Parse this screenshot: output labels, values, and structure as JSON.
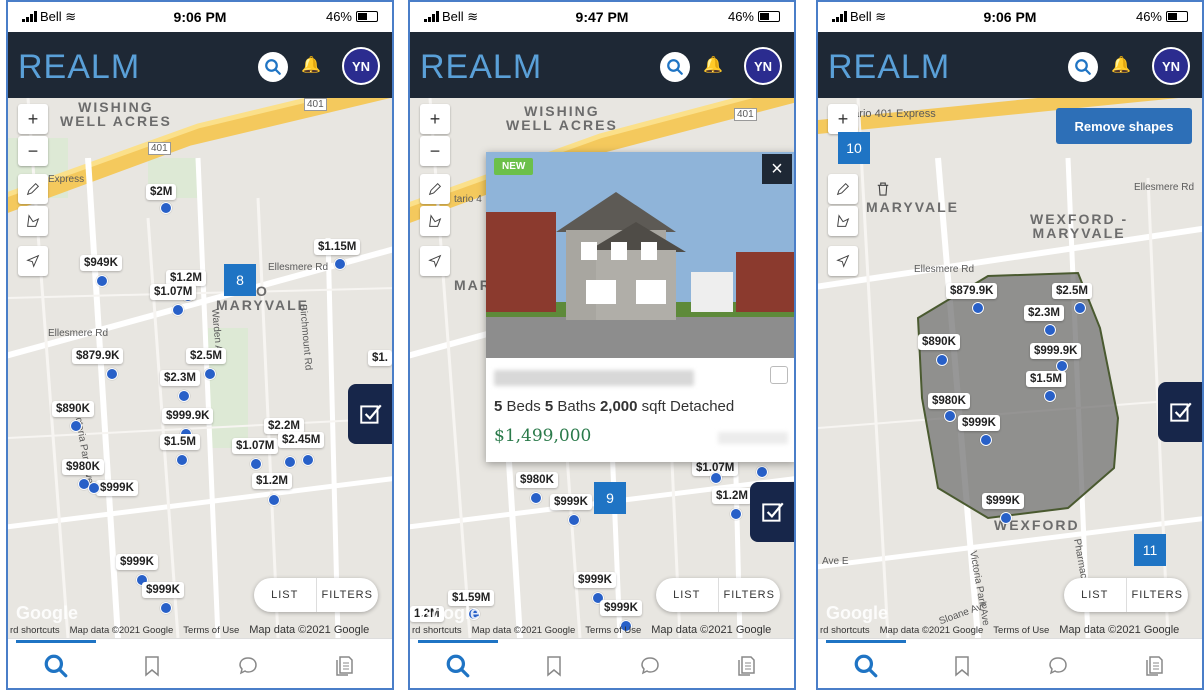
{
  "screens": [
    {
      "status": {
        "carrier": "Bell",
        "time": "9:06 PM",
        "battery": "46%"
      },
      "header": {
        "logo": "REALM",
        "avatar": "YN"
      },
      "map_labels": {
        "area1": "WISHING\nWELL ACRES",
        "area2": "O\nMARYVALE",
        "hwy": "401",
        "hwy2": "401",
        "express": "Express",
        "ellesmere": "Ellesmere Rd",
        "ellesmere2": "Ellesmere Rd",
        "birchmount": "Birchmount Rd",
        "victoria": "Victoria Park Ave",
        "warden": "Warden Ave"
      },
      "prices": [
        "$2M",
        "$1.15M",
        "$949K",
        "$1.2M",
        "$1.07M",
        "$879.9K",
        "$2.5M",
        "$2.3M",
        "$890K",
        "$999.9K",
        "$2.2M",
        "$1.5M",
        "$1.07M",
        "$2.45M",
        "$980K",
        "$1.2M",
        "$999K",
        "$999K",
        "$999K",
        "$1."
      ],
      "cluster": "8",
      "list_label": "LIST",
      "filters_label": "FILTERS",
      "footer": {
        "shortcuts": "rd shortcuts",
        "mapdata": "Map data ©2021 Google",
        "terms": "Terms of Use",
        "mapdata2": "Map data ©2021 Google"
      }
    },
    {
      "status": {
        "carrier": "Bell",
        "time": "9:47 PM",
        "battery": "46%"
      },
      "header": {
        "logo": "REALM",
        "avatar": "YN"
      },
      "map_labels": {
        "area1": "WISHING\nWELL ACRES",
        "area2": "MAR",
        "hwy": "401",
        "express": "tario 4"
      },
      "card": {
        "badge": "NEW",
        "beds": "5",
        "beds_label": "Beds",
        "baths": "5",
        "baths_label": "Baths",
        "sqft": "2,000",
        "sqft_label": "sqft",
        "type": "Detached",
        "price": "$1,499,000"
      },
      "prices": [
        "$980K",
        "$999K",
        "$1.07M",
        "$1.2M",
        "$999K",
        "$1.59M",
        "$999K",
        "1.2M"
      ],
      "cluster": "9",
      "list_label": "LIST",
      "filters_label": "FILTERS",
      "footer": {
        "shortcuts": "rd shortcuts",
        "mapdata": "Map data ©2021 Google",
        "terms": "Terms of Use",
        "mapdata2": "Map data ©2021 Google"
      }
    },
    {
      "status": {
        "carrier": "Bell",
        "time": "9:06 PM",
        "battery": "46%"
      },
      "header": {
        "logo": "REALM",
        "avatar": "YN"
      },
      "map_labels": {
        "area1": "MARYVALE",
        "area2": "WEXFORD -\nMARYVALE",
        "area3": "WEXFORD",
        "express": "ntario 401 Express",
        "ellesmere": "Ellesmere Rd",
        "ellesmere2": "Ellesmere Rd",
        "victoria": "Victoria Park Ave",
        "pharmacy": "Pharmacy Ave",
        "sloane": "Sloane Ave",
        "avee": "Ave E"
      },
      "remove_shapes": "Remove shapes",
      "prices": [
        "$879.9K",
        "$2.5M",
        "$2.3M",
        "$890K",
        "$999.9K",
        "$1.5M",
        "$980K",
        "$999K",
        "$999K"
      ],
      "cluster_a": "10",
      "cluster_b": "11",
      "list_label": "LIST",
      "filters_label": "FILTERS",
      "footer": {
        "shortcuts": "rd shortcuts",
        "mapdata": "Map data ©2021 Google",
        "terms": "Terms of Use",
        "mapdata2": "Map data ©2021 Google"
      }
    }
  ],
  "colors": {
    "header": "#1e2835",
    "accent": "#1f74c4",
    "pin": "#2860c8",
    "price_green": "#2a7a4a"
  },
  "icons": [
    "search-icon",
    "bell-icon",
    "plus-icon",
    "minus-icon",
    "pencil-icon",
    "polygon-icon",
    "navigate-icon",
    "checkbox-icon",
    "bookmark-icon",
    "chat-icon",
    "document-icon",
    "trash-icon",
    "close-icon"
  ]
}
